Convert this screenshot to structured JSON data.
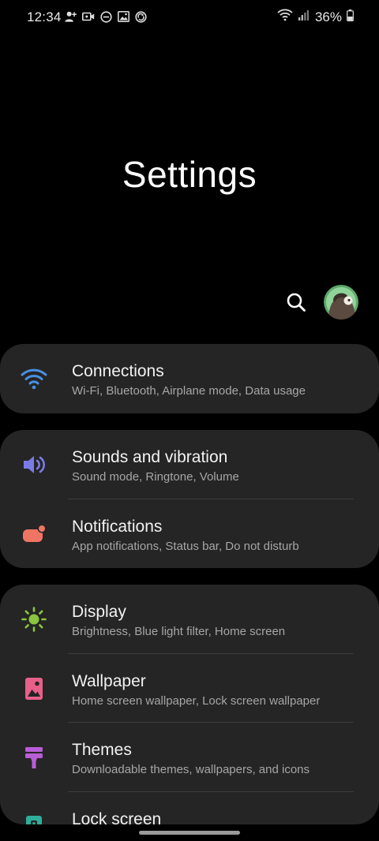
{
  "status_bar": {
    "time": "12:34",
    "battery_percent": "36%",
    "left_icons": [
      "add-person-icon",
      "video-call-icon",
      "do-not-disturb-icon",
      "image-icon",
      "sync-icon"
    ],
    "right_icons": [
      "wifi-icon",
      "signal-icon",
      "battery-icon"
    ]
  },
  "header": {
    "title": "Settings"
  },
  "groups": [
    {
      "items": [
        {
          "title": "Connections",
          "subtitle": "Wi-Fi, Bluetooth, Airplane mode, Data usage",
          "icon": "wifi-icon",
          "color": "#4a90e2"
        }
      ]
    },
    {
      "items": [
        {
          "title": "Sounds and vibration",
          "subtitle": "Sound mode, Ringtone, Volume",
          "icon": "speaker-icon",
          "color": "#7b7be8"
        },
        {
          "title": "Notifications",
          "subtitle": "App notifications, Status bar, Do not disturb",
          "icon": "notification-icon",
          "color": "#f07464"
        }
      ]
    },
    {
      "items": [
        {
          "title": "Display",
          "subtitle": "Brightness, Blue light filter, Home screen",
          "icon": "sun-icon",
          "color": "#8bc53f"
        },
        {
          "title": "Wallpaper",
          "subtitle": "Home screen wallpaper, Lock screen wallpaper",
          "icon": "wallpaper-icon",
          "color": "#e8608a"
        },
        {
          "title": "Themes",
          "subtitle": "Downloadable themes, wallpapers, and icons",
          "icon": "paint-brush-icon",
          "color": "#b85dd6"
        },
        {
          "title": "Lock screen",
          "subtitle": "",
          "icon": "lock-icon",
          "color": "#2fae9c"
        }
      ]
    }
  ]
}
